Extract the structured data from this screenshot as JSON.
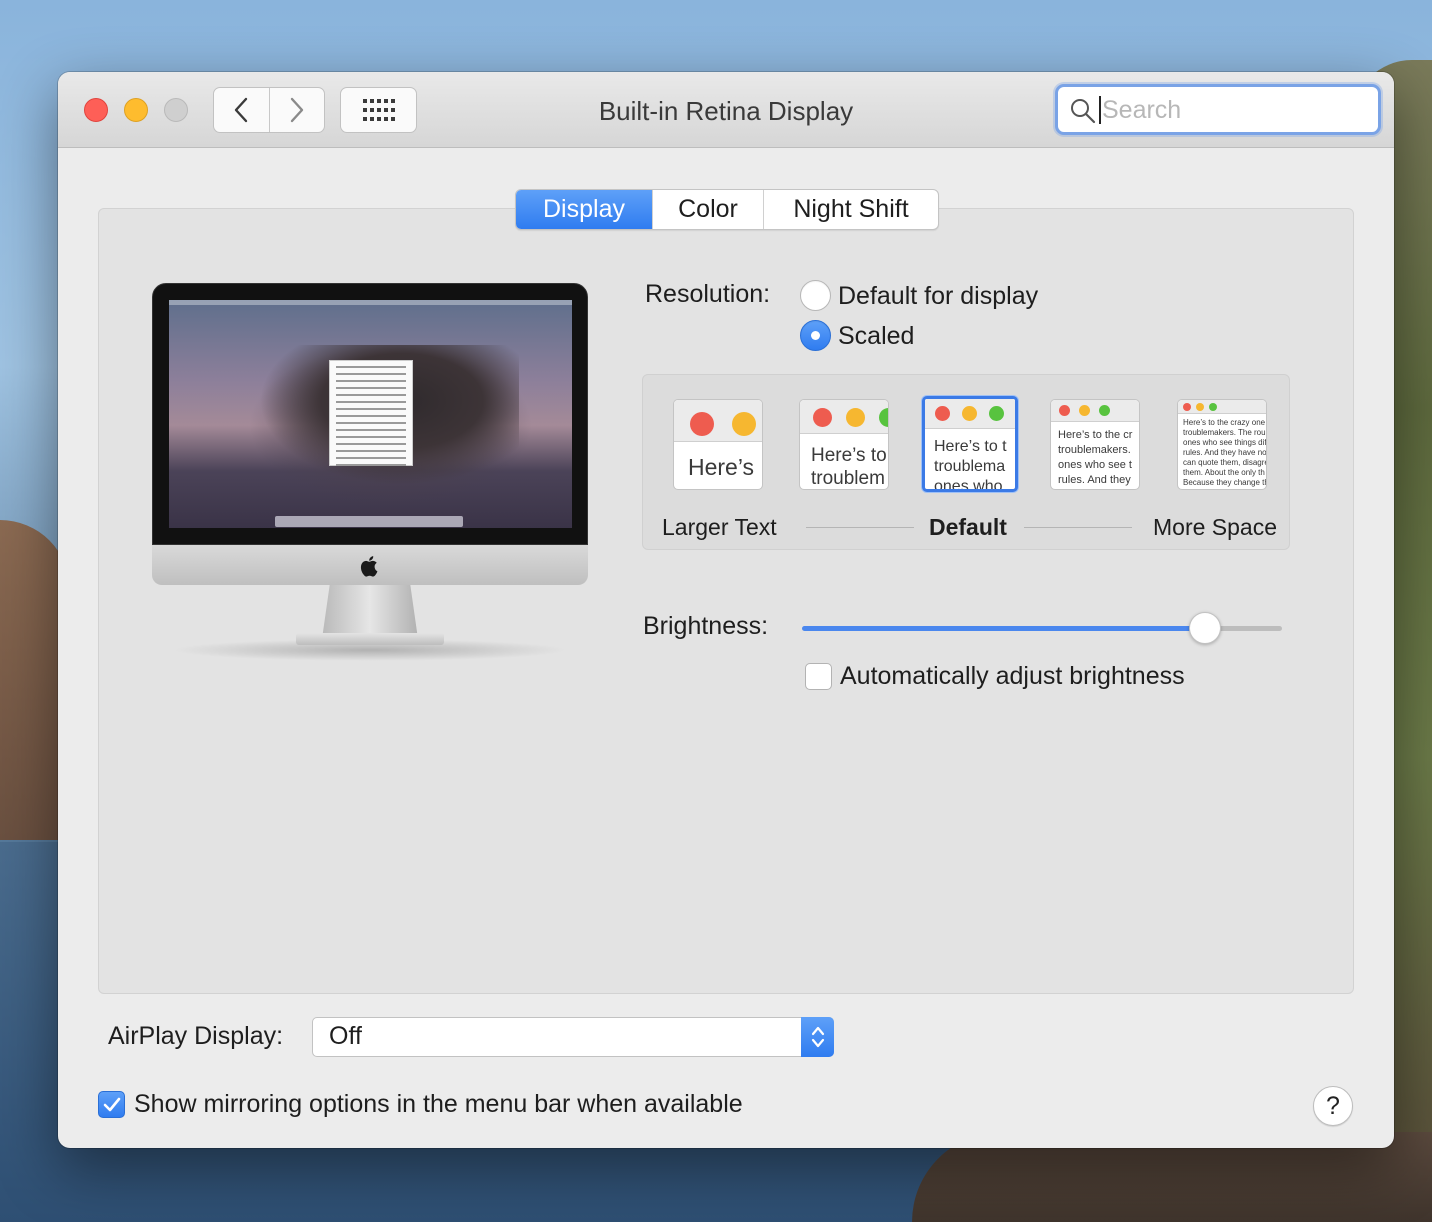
{
  "window": {
    "title": "Built-in Retina Display"
  },
  "search": {
    "placeholder": "Search",
    "value": ""
  },
  "tabs": [
    {
      "label": "Display",
      "active": true
    },
    {
      "label": "Color",
      "active": false
    },
    {
      "label": "Night Shift",
      "active": false
    }
  ],
  "resolution": {
    "label": "Resolution:",
    "options": [
      {
        "label": "Default for display",
        "selected": false
      },
      {
        "label": "Scaled",
        "selected": true
      }
    ]
  },
  "scaled_options": {
    "selected_index": 2,
    "thumbs": [
      {
        "text": "Here’s"
      },
      {
        "text": "Here’s to\ntroublem"
      },
      {
        "text": "Here’s to t\ntroublema\nones who"
      },
      {
        "text": "Here’s to the cr\ntroublemakers.\nones who see t\nrules. And they"
      },
      {
        "text": "Here’s to the crazy one\ntroublemakers. The rou\nones who see things dif\nrules. And they have no\ncan quote them, disagre\nthem. About the only th\nBecause they change th"
      }
    ],
    "left_label": "Larger Text",
    "center_label": "Default",
    "right_label": "More Space"
  },
  "brightness": {
    "label": "Brightness:",
    "level_fraction": 0.84,
    "auto_label": "Automatically adjust brightness",
    "auto_checked": false
  },
  "airplay": {
    "label": "AirPlay Display:",
    "value": "Off"
  },
  "mirroring": {
    "label": "Show mirroring options in the menu bar when available",
    "checked": true
  },
  "help": {
    "label": "?"
  },
  "colors": {
    "accent": "#2f7cf0",
    "close": "#fe5f57",
    "minimize": "#febc2e"
  }
}
